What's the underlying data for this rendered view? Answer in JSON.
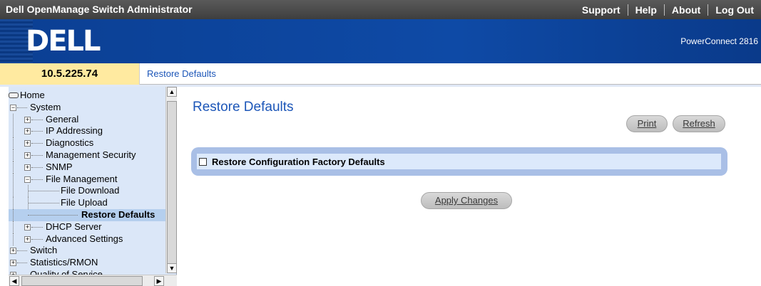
{
  "topbar": {
    "title": "Dell OpenManage Switch Administrator",
    "links": [
      "Support",
      "Help",
      "About",
      "Log Out"
    ]
  },
  "brand": {
    "logo": "DELL",
    "model": "PowerConnect 2816"
  },
  "address": {
    "ip": "10.5.225.74",
    "breadcrumb": "Restore Defaults"
  },
  "tree": {
    "home": "Home",
    "system": "System",
    "general": "General",
    "ip_addressing": "IP Addressing",
    "diagnostics": "Diagnostics",
    "management_security": "Management Security",
    "snmp": "SNMP",
    "file_management": "File Management",
    "file_download": "File Download",
    "file_upload": "File Upload",
    "restore_defaults": "Restore Defaults",
    "dhcp_server": "DHCP Server",
    "advanced_settings": "Advanced Settings",
    "switch": "Switch",
    "statistics_rmon": "Statistics/RMON",
    "quality_of_service": "Quality of Service",
    "selected": "Restore Defaults"
  },
  "main": {
    "title": "Restore Defaults",
    "print_label": "Print",
    "refresh_label": "Refresh",
    "option_label": "Restore Configuration Factory Defaults",
    "option_checked": false,
    "apply_label": "Apply Changes"
  },
  "colors": {
    "brand_blue": "#0e4aa6",
    "link_blue": "#1c56b8",
    "ip_bg": "#ffeaa0",
    "tree_bg": "#dbe7f8",
    "panel_border": "#a9bfe6"
  }
}
